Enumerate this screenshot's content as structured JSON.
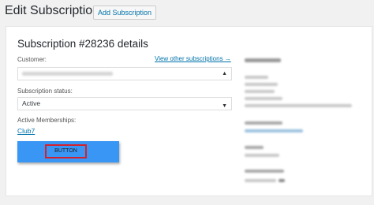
{
  "header": {
    "title": "Edit Subscription",
    "add_button_label": "Add Subscription"
  },
  "details": {
    "title": "Subscription #28236 details",
    "customer_label": "Customer:",
    "view_other_link": "View other subscriptions →",
    "status_label": "Subscription status:",
    "status_value": "Active",
    "memberships_label": "Active Memberships:",
    "membership_link": "Club7",
    "button_label": "BUTTON"
  },
  "colors": {
    "link": "#0073aa",
    "blue_block": "#3a96f5",
    "red_outline": "#d2222d"
  },
  "icons": {
    "select_arrow": "chevron-down-icon",
    "phone_icon": "phone-icon"
  }
}
